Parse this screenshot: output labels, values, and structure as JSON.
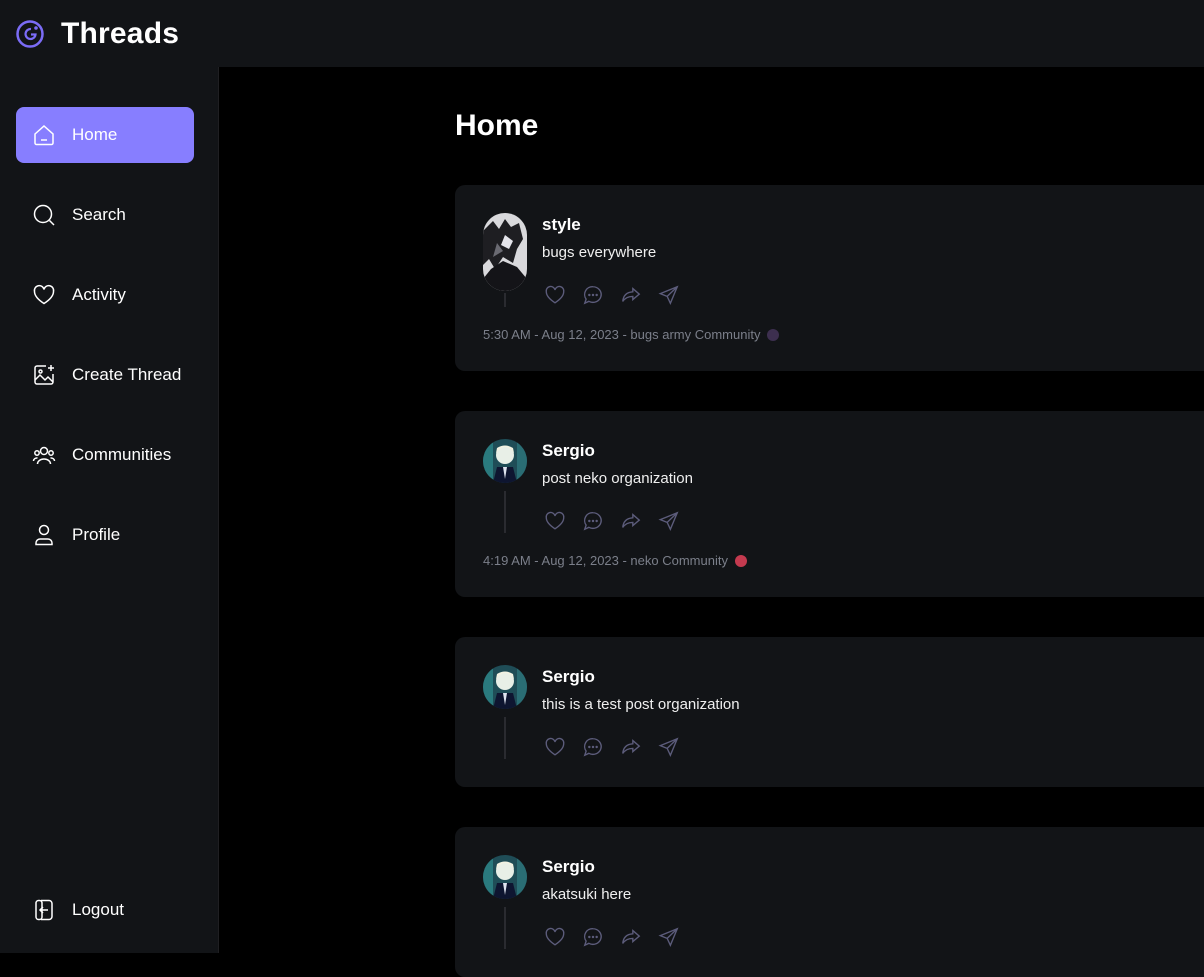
{
  "app": {
    "title": "Threads"
  },
  "colors": {
    "accent": "#877eff",
    "panel": "#121417",
    "background": "#000000"
  },
  "sidebar": {
    "items": [
      {
        "label": "Home",
        "icon": "home-icon",
        "active": true
      },
      {
        "label": "Search",
        "icon": "search-icon"
      },
      {
        "label": "Activity",
        "icon": "heart-icon"
      },
      {
        "label": "Create Thread",
        "icon": "image-plus-icon"
      },
      {
        "label": "Communities",
        "icon": "users-icon"
      },
      {
        "label": "Profile",
        "icon": "user-icon"
      }
    ],
    "logout": {
      "label": "Logout",
      "icon": "logout-icon"
    }
  },
  "main": {
    "title": "Home",
    "threads": [
      {
        "author": "style",
        "text": "bugs everywhere",
        "meta": "5:30 AM - Aug 12, 2023 - bugs army Community"
      },
      {
        "author": "Sergio",
        "text": "post neko organization",
        "meta": "4:19 AM - Aug 12, 2023 - neko Community"
      },
      {
        "author": "Sergio",
        "text": "this is a test post organization"
      },
      {
        "author": "Sergio",
        "text": "akatsuki here"
      }
    ]
  }
}
